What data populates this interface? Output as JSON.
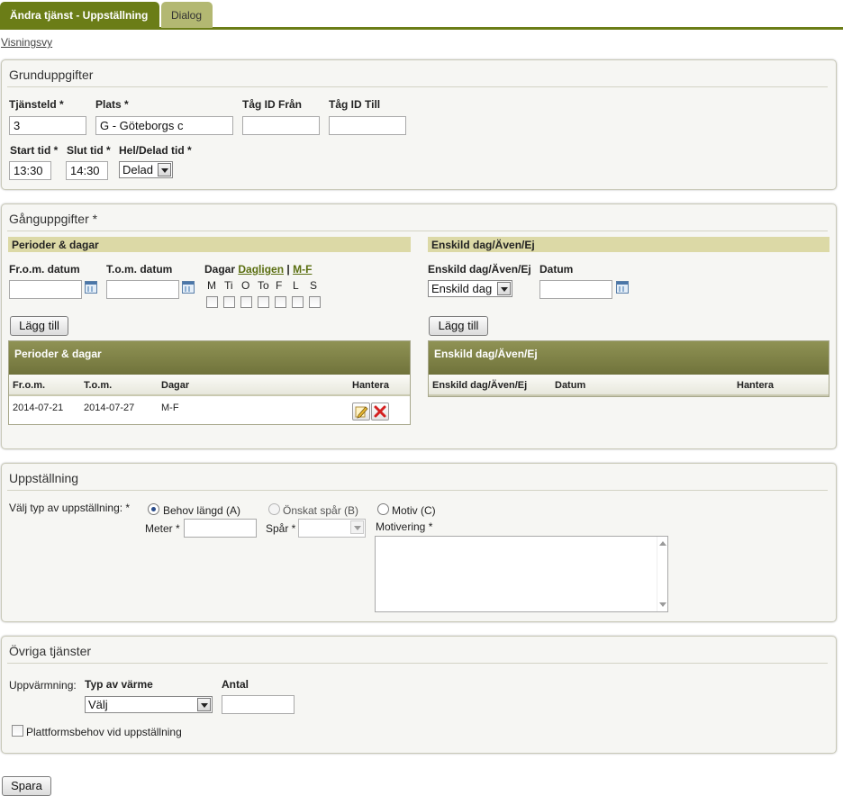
{
  "tabs": [
    {
      "label": "Ändra tjänst - Uppställning",
      "active": true
    },
    {
      "label": "Dialog",
      "active": false
    }
  ],
  "view_link": "Visningsvy",
  "grunduppgifter": {
    "title": "Grunduppgifter",
    "tjansteid": {
      "label": "Tjänsteld *",
      "value": "3"
    },
    "plats": {
      "label": "Plats *",
      "value": "G - Göteborgs c"
    },
    "tag_id_fran": {
      "label": "Tåg ID Från",
      "value": ""
    },
    "tag_id_till": {
      "label": "Tåg ID Till",
      "value": ""
    },
    "start_tid": {
      "label": "Start tid *",
      "value": "13:30"
    },
    "slut_tid": {
      "label": "Slut tid *",
      "value": "14:30"
    },
    "hel_delad": {
      "label": "Hel/Delad tid *",
      "value": "Delad"
    }
  },
  "ganguppgifter": {
    "title": "Gånguppgifter *",
    "perioder": {
      "header": "Perioder & dagar",
      "from_label": "Fr.o.m. datum",
      "tom_label": "T.o.m. datum",
      "dagar_label": "Dagar",
      "dagligen_link": "Dagligen",
      "separator": "|",
      "mf_link": "M-F",
      "days": [
        "M",
        "Ti",
        "O",
        "To",
        "F",
        "L",
        "S"
      ],
      "add_button": "Lägg till",
      "grid_title": "Perioder & dagar",
      "columns": [
        "Fr.o.m.",
        "T.o.m.",
        "Dagar",
        "Hantera"
      ],
      "rows": [
        {
          "from": "2014-07-21",
          "tom": "2014-07-27",
          "dagar": "M-F"
        }
      ]
    },
    "enskild": {
      "header": "Enskild dag/Även/Ej",
      "type_label": "Enskild dag/Även/Ej",
      "type_value": "Enskild dag",
      "datum_label": "Datum",
      "add_button": "Lägg till",
      "grid_title": "Enskild dag/Även/Ej",
      "columns": [
        "Enskild dag/Även/Ej",
        "Datum",
        "Hantera"
      ]
    }
  },
  "uppstallning": {
    "title": "Uppställning",
    "type_label": "Välj typ av uppställning: *",
    "options": [
      {
        "label": "Behov längd (A)",
        "checked": true,
        "disabled": false
      },
      {
        "label": "Önskat spår (B)",
        "checked": false,
        "disabled": true
      },
      {
        "label": "Motiv (C)",
        "checked": false,
        "disabled": false
      }
    ],
    "meter_label": "Meter *",
    "spar_label": "Spår *",
    "motivering_label": "Motivering *"
  },
  "ovriga": {
    "title": "Övriga tjänster",
    "uppvarmning_label": "Uppvärmning:",
    "typ_label": "Typ av värme",
    "typ_value": "Välj",
    "antal_label": "Antal",
    "plattform_label": "Plattformsbehov vid uppställning"
  },
  "save_button": "Spara",
  "colors": {
    "tab_active": "#6b7d17",
    "tab_inactive": "#b3b872",
    "grid_header": "#7f8247",
    "sub_header": "#dcd9a6"
  }
}
